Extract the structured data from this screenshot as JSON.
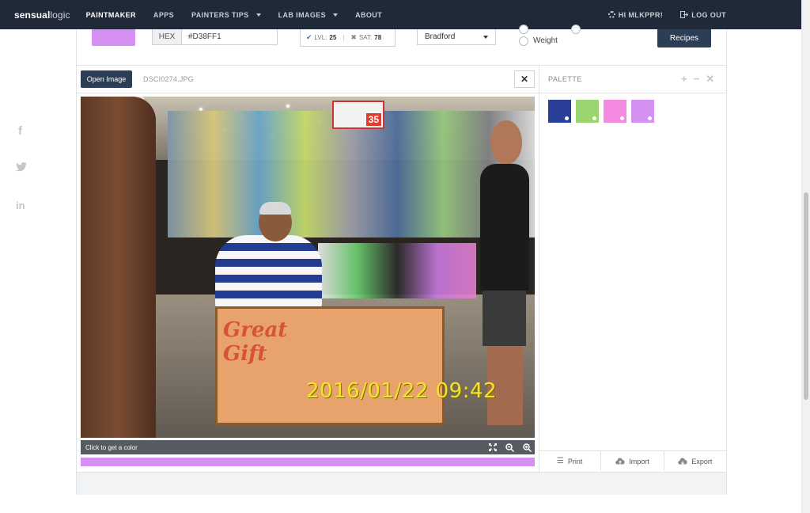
{
  "nav": {
    "logo_bold": "sensual",
    "logo_light": "logic",
    "items": [
      {
        "label": "PAINTMAKER",
        "active": true,
        "dropdown": false
      },
      {
        "label": "APPS",
        "active": false,
        "dropdown": false
      },
      {
        "label": "PAINTERS TIPS",
        "active": false,
        "dropdown": true
      },
      {
        "label": "LAB IMAGES",
        "active": false,
        "dropdown": true
      },
      {
        "label": "ABOUT",
        "active": false,
        "dropdown": false
      }
    ],
    "user_greeting": "HI MLKPPR!",
    "logout": "LOG OUT"
  },
  "social": {
    "facebook": "f",
    "linkedin": "in"
  },
  "toolbar": {
    "current_color": "#d38ff1",
    "hex_label": "HEX",
    "hex_value": "#D38FF1",
    "lvl_label": "LVL:",
    "lvl_value": "25",
    "sat_label": "SAT:",
    "sat_value": "78",
    "brand_select": "Bradford",
    "weight_label": "Weight",
    "recipes_button": "Recipes"
  },
  "image_panel": {
    "open_button": "Open Image",
    "filename": "DSCI0274.JPG",
    "close_icon": "close-icon",
    "photo_sale_sign": "35",
    "photo_sign_text": "Great Gift",
    "photo_timestamp": "2016/01/22 09:42",
    "status_text": "Click to get a color",
    "tools": [
      "fullscreen-icon",
      "zoom-out-icon",
      "zoom-in-icon"
    ],
    "picked_color": "#d38ff1"
  },
  "palette": {
    "title": "PALETTE",
    "actions": [
      "add-icon",
      "remove-icon",
      "clear-icon"
    ],
    "swatches": [
      "#2a3f97",
      "#9ad56f",
      "#f48be0",
      "#d38ff1"
    ],
    "footer": {
      "print": "Print",
      "import": "Import",
      "export": "Export"
    }
  }
}
